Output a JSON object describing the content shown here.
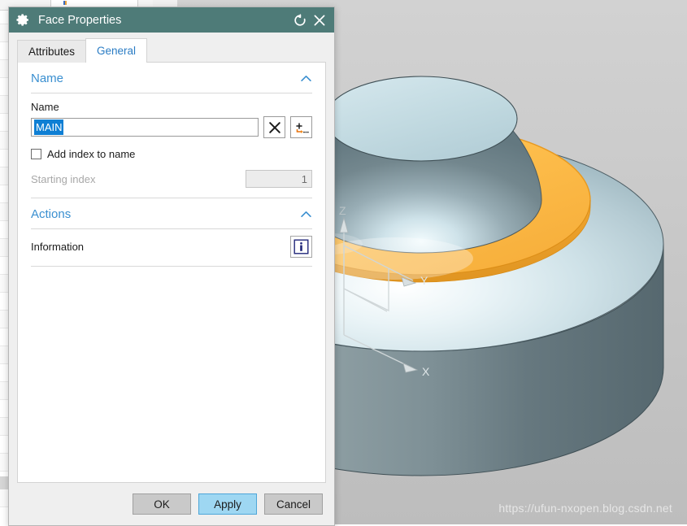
{
  "window": {
    "title": "Face Properties",
    "gear_icon": "gear-icon",
    "reset_icon": "reset-circular-arrow-icon",
    "close_icon": "close-x-icon"
  },
  "tabs": [
    {
      "label": "Attributes",
      "active": false
    },
    {
      "label": "General",
      "active": true
    }
  ],
  "groups": {
    "name": {
      "title": "Name",
      "collapse_icon": "chevron-up-icon",
      "field_label": "Name",
      "input_value": "MAIN",
      "input_selected": true,
      "clear_button_icon": "close-x-icon",
      "add_button_icon": "plus-arrow-ellipsis-icon",
      "checkbox_label": "Add index to name",
      "checkbox_checked": false,
      "starting_index_label": "Starting index",
      "starting_index_value": "1",
      "starting_index_disabled": true
    },
    "actions": {
      "title": "Actions",
      "collapse_icon": "chevron-up-icon",
      "information_label": "Information",
      "information_icon": "info-i-icon"
    }
  },
  "footer": {
    "ok_label": "OK",
    "apply_label": "Apply",
    "cancel_label": "Cancel"
  },
  "viewport": {
    "watermark": "https://ufun-nxopen.blog.csdn.net",
    "axis_x_label": "X",
    "axis_y_label": "Y",
    "axis_z_label": "Z",
    "model_description": "Revolved boss with highlighted annular face",
    "highlight_color": "#FDBA4D",
    "body_color": "#7D8E93",
    "top_face_color": "#C3DAE0"
  }
}
